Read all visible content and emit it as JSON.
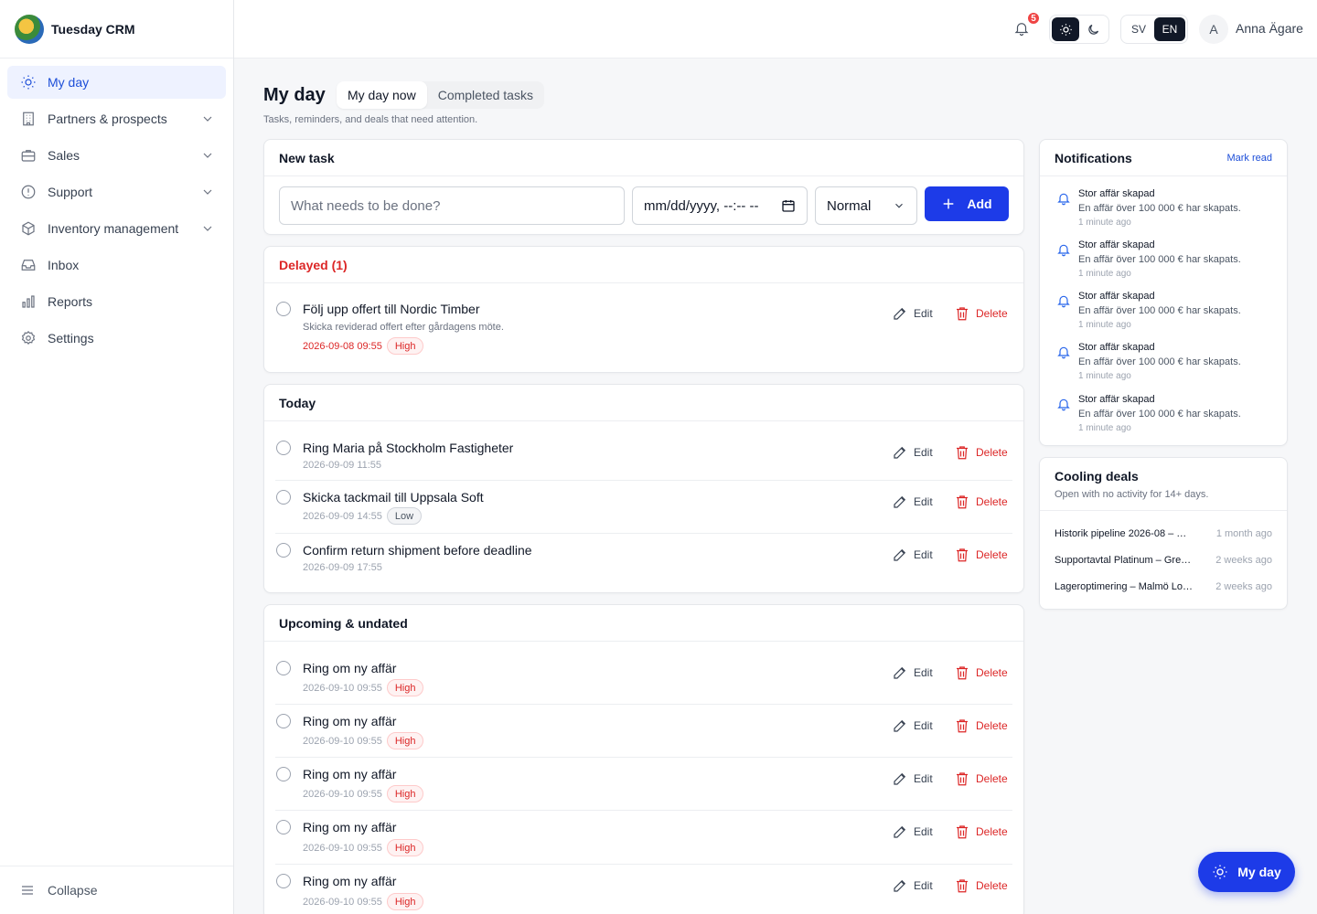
{
  "app": {
    "name": "Tuesday CRM"
  },
  "sidebar": {
    "items": [
      {
        "label": "My day",
        "icon": "sun-icon",
        "active": true
      },
      {
        "label": "Partners & prospects",
        "icon": "building-icon",
        "expandable": true
      },
      {
        "label": "Sales",
        "icon": "briefcase-icon",
        "expandable": true
      },
      {
        "label": "Support",
        "icon": "lifebuoy-icon",
        "expandable": true
      },
      {
        "label": "Inventory management",
        "icon": "box-icon",
        "expandable": true
      },
      {
        "label": "Inbox",
        "icon": "inbox-icon"
      },
      {
        "label": "Reports",
        "icon": "bar-chart-icon"
      },
      {
        "label": "Settings",
        "icon": "gear-icon"
      }
    ],
    "collapse_label": "Collapse"
  },
  "topbar": {
    "notification_count": "5",
    "lang_sv": "SV",
    "lang_en": "EN",
    "active_lang": "EN",
    "avatar_initial": "A",
    "user_name": "Anna Ägare"
  },
  "page": {
    "title": "My day",
    "tabs": [
      "My day now",
      "Completed tasks"
    ],
    "active_tab": "My day now",
    "subtitle": "Tasks, reminders, and deals that need attention."
  },
  "new_task": {
    "heading": "New task",
    "placeholder": "What needs to be done?",
    "date_placeholder": "mm/dd/yyyy, --:-- --",
    "priority": "Normal",
    "add_label": "Add"
  },
  "actions": {
    "edit": "Edit",
    "delete": "Delete"
  },
  "delayed": {
    "heading": "Delayed (1)",
    "tasks": [
      {
        "title": "Följ upp offert till Nordic Timber",
        "description": "Skicka reviderad offert efter gårdagens möte.",
        "date": "2026-09-08 09:55",
        "priority": "High"
      }
    ]
  },
  "today": {
    "heading": "Today",
    "tasks": [
      {
        "title": "Ring Maria på Stockholm Fastigheter",
        "date": "2026-09-09 11:55",
        "priority": ""
      },
      {
        "title": "Skicka tackmail till Uppsala Soft",
        "date": "2026-09-09 14:55",
        "priority": "Low"
      },
      {
        "title": "Confirm return shipment before deadline",
        "date": "2026-09-09 17:55",
        "priority": ""
      }
    ]
  },
  "upcoming": {
    "heading": "Upcoming & undated",
    "tasks": [
      {
        "title": "Ring om ny affär",
        "date": "2026-09-10 09:55",
        "priority": "High"
      },
      {
        "title": "Ring om ny affär",
        "date": "2026-09-10 09:55",
        "priority": "High"
      },
      {
        "title": "Ring om ny affär",
        "date": "2026-09-10 09:55",
        "priority": "High"
      },
      {
        "title": "Ring om ny affär",
        "date": "2026-09-10 09:55",
        "priority": "High"
      },
      {
        "title": "Ring om ny affär",
        "date": "2026-09-10 09:55",
        "priority": "High"
      }
    ]
  },
  "notifications": {
    "heading": "Notifications",
    "mark_read": "Mark read",
    "items": [
      {
        "title": "Stor affär skapad",
        "body": "En affär över 100 000 € har skapats.",
        "time": "1 minute ago"
      },
      {
        "title": "Stor affär skapad",
        "body": "En affär över 100 000 € har skapats.",
        "time": "1 minute ago"
      },
      {
        "title": "Stor affär skapad",
        "body": "En affär över 100 000 € har skapats.",
        "time": "1 minute ago"
      },
      {
        "title": "Stor affär skapad",
        "body": "En affär över 100 000 € har skapats.",
        "time": "1 minute ago"
      },
      {
        "title": "Stor affär skapad",
        "body": "En affär över 100 000 € har skapats.",
        "time": "1 minute ago"
      }
    ]
  },
  "cooling": {
    "heading": "Cooling deals",
    "subtitle": "Open with no activity for 14+ days.",
    "deals": [
      {
        "name": "Historik pipeline 2026-08 – …",
        "time": "1 month ago"
      },
      {
        "name": "Supportavtal Platinum – Gre…",
        "time": "2 weeks ago"
      },
      {
        "name": "Lageroptimering – Malmö Lo…",
        "time": "2 weeks ago"
      }
    ]
  },
  "fab": {
    "label": "My day"
  },
  "colors": {
    "accent": "#1d3be8",
    "danger": "#dc2626",
    "active_nav_bg": "#eef2ff"
  }
}
